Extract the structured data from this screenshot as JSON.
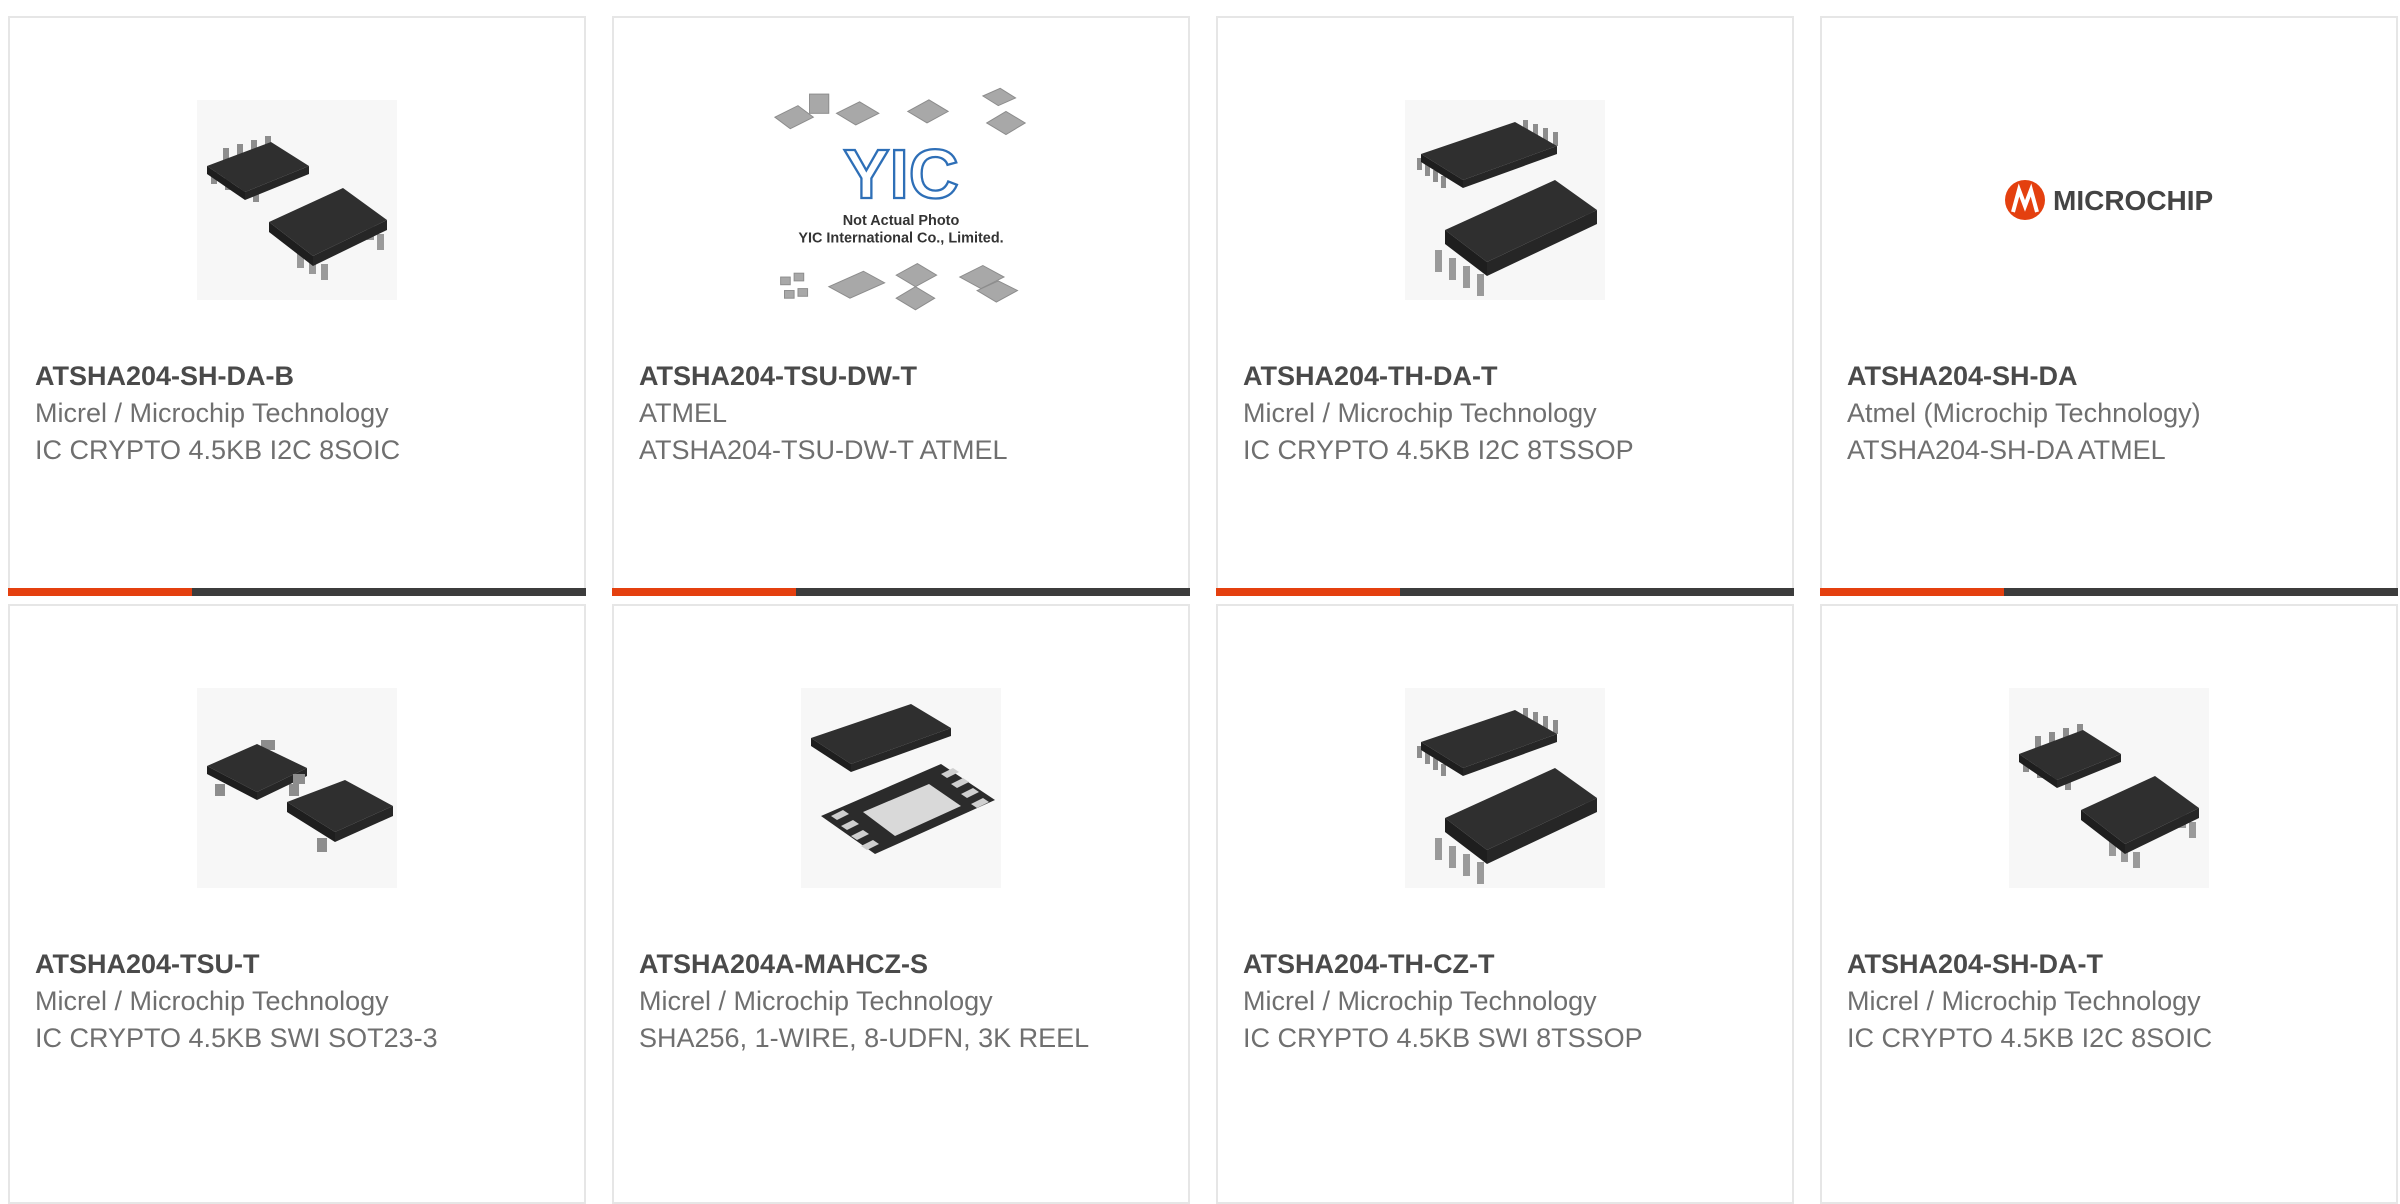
{
  "products": [
    {
      "part": "ATSHA204-SH-DA-B",
      "maker": "Micrel / Microchip Technology",
      "desc": "IC CRYPTO 4.5KB I2C 8SOIC",
      "image": "soic8-chip-icon"
    },
    {
      "part": "ATSHA204-TSU-DW-T",
      "maker": "ATMEL",
      "desc": "ATSHA204-TSU-DW-T ATMEL",
      "image": "placeholder-photo-icon",
      "placeholder": {
        "logo": "YIC",
        "line1": "Not Actual Photo",
        "line2": "YIC International Co., Limited."
      }
    },
    {
      "part": "ATSHA204-TH-DA-T",
      "maker": "Micrel / Microchip Technology",
      "desc": "IC CRYPTO 4.5KB I2C 8TSSOP",
      "image": "tssop8-chip-icon"
    },
    {
      "part": "ATSHA204-SH-DA",
      "maker": "Atmel (Microchip Technology)",
      "desc": "ATSHA204-SH-DA ATMEL",
      "image": "microchip-logo",
      "logo_text": "MICROCHIP"
    },
    {
      "part": "ATSHA204-TSU-T",
      "maker": "Micrel / Microchip Technology",
      "desc": "IC CRYPTO 4.5KB SWI SOT23-3",
      "image": "sot23-chip-icon"
    },
    {
      "part": "ATSHA204A-MAHCZ-S",
      "maker": "Micrel / Microchip Technology",
      "desc": "SHA256, 1-WIRE, 8-UDFN, 3K REEL",
      "image": "udfn8-chip-icon"
    },
    {
      "part": "ATSHA204-TH-CZ-T",
      "maker": "Micrel / Microchip Technology",
      "desc": "IC CRYPTO 4.5KB SWI 8TSSOP",
      "image": "tssop8-chip-icon"
    },
    {
      "part": "ATSHA204-SH-DA-T",
      "maker": "Micrel / Microchip Technology",
      "desc": "IC CRYPTO 4.5KB I2C 8SOIC",
      "image": "soic8-chip-icon"
    }
  ],
  "colors": {
    "accent": "#e4400f",
    "bar": "#3c3c3c",
    "title": "#4a4a4a",
    "text": "#6f6f6f",
    "border": "#e6e6e6"
  }
}
